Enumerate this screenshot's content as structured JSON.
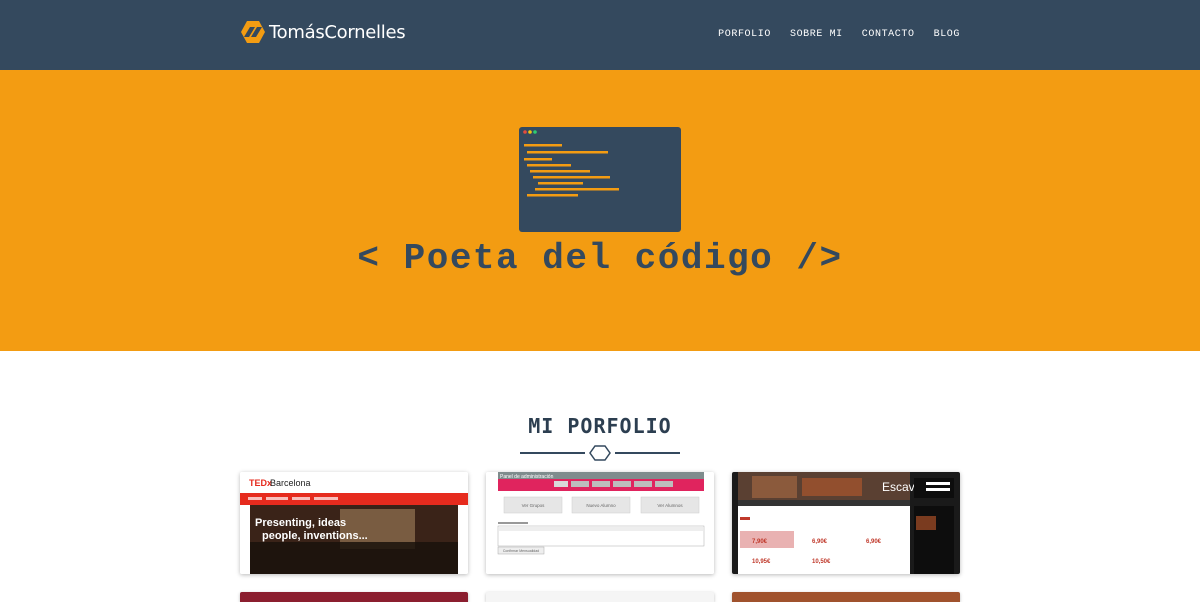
{
  "brand": {
    "name": "TomásCornelles",
    "logo_icon": "hexagon-slash-logo",
    "logo_color": "#f39c12"
  },
  "nav": {
    "items": [
      {
        "label": "PORFOLIO"
      },
      {
        "label": "SOBRE MI"
      },
      {
        "label": "CONTACTO"
      },
      {
        "label": "BLOG"
      }
    ]
  },
  "hero": {
    "title": "< Poeta del código />",
    "icon": "code-editor-icon",
    "background": "#f39c12",
    "text_color": "#34495e"
  },
  "portfolio": {
    "title": "MI PORFOLIO",
    "divider_icon": "hexagon-icon",
    "items": [
      {
        "name": "tedx-barcelona",
        "thumb_brand_ted": "TEDx",
        "thumb_brand_city": "Barcelona",
        "thumb_headline_1": "Presenting, ideas",
        "thumb_headline_2": "people, inventions..."
      },
      {
        "name": "panel-administracion",
        "thumb_header": "Panel de administración",
        "thumb_buttons": [
          "Ver Grupos",
          "Nuevo Alumno",
          "Ver Alumnos"
        ],
        "thumb_footer_button": "Confirmar Mensualidad"
      },
      {
        "name": "escavia",
        "thumb_brand": "Escavia",
        "thumb_prices": [
          "7,90€",
          "6,90€",
          "10,95€",
          "10,50€",
          "6,90€"
        ]
      }
    ]
  },
  "colors": {
    "navbar": "#34495e",
    "accent": "#f39c12",
    "heading": "#2c3e50"
  }
}
